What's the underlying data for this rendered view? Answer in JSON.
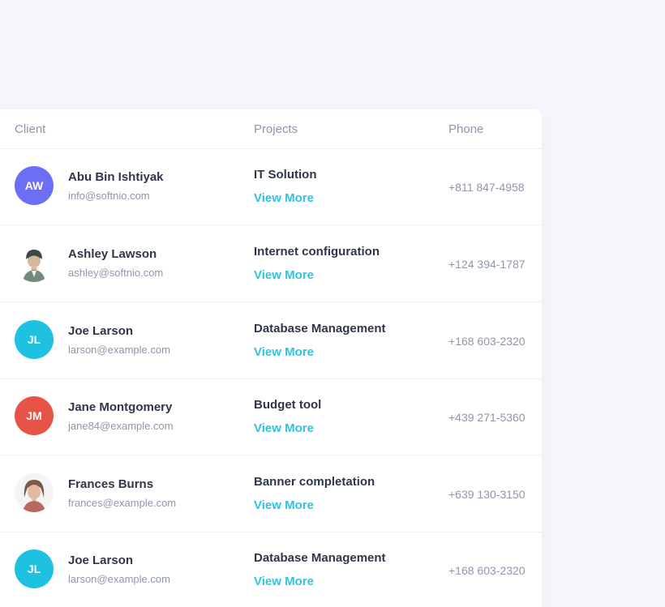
{
  "table": {
    "headers": {
      "client": "Client",
      "projects": "Projects",
      "phone": "Phone"
    },
    "rows": [
      {
        "avatar": {
          "type": "initials",
          "text": "AW",
          "color": "#6c6ff5"
        },
        "name": "Abu Bin Ishtiyak",
        "email": "info@softnio.com",
        "project": "IT Solution",
        "link": "View More",
        "phone": "+811 847-4958"
      },
      {
        "avatar": {
          "type": "photo",
          "icon": "person-photo-male-icon"
        },
        "name": "Ashley Lawson",
        "email": "ashley@softnio.com",
        "project": "Internet configuration",
        "link": "View More",
        "phone": "+124 394-1787"
      },
      {
        "avatar": {
          "type": "initials",
          "text": "JL",
          "color": "#1fc1e0"
        },
        "name": "Joe Larson",
        "email": "larson@example.com",
        "project": "Database Management",
        "link": "View More",
        "phone": "+168 603-2320"
      },
      {
        "avatar": {
          "type": "initials",
          "text": "JM",
          "color": "#e85347"
        },
        "name": "Jane Montgomery",
        "email": "jane84@example.com",
        "project": "Budget tool",
        "link": "View More",
        "phone": "+439 271-5360"
      },
      {
        "avatar": {
          "type": "photo",
          "icon": "person-photo-female-icon"
        },
        "name": "Frances Burns",
        "email": "frances@example.com",
        "project": "Banner completation",
        "link": "View More",
        "phone": "+639 130-3150"
      },
      {
        "avatar": {
          "type": "initials",
          "text": "JL",
          "color": "#1fc1e0"
        },
        "name": "Joe Larson",
        "email": "larson@example.com",
        "project": "Database Management",
        "link": "View More",
        "phone": "+168 603-2320"
      }
    ]
  }
}
